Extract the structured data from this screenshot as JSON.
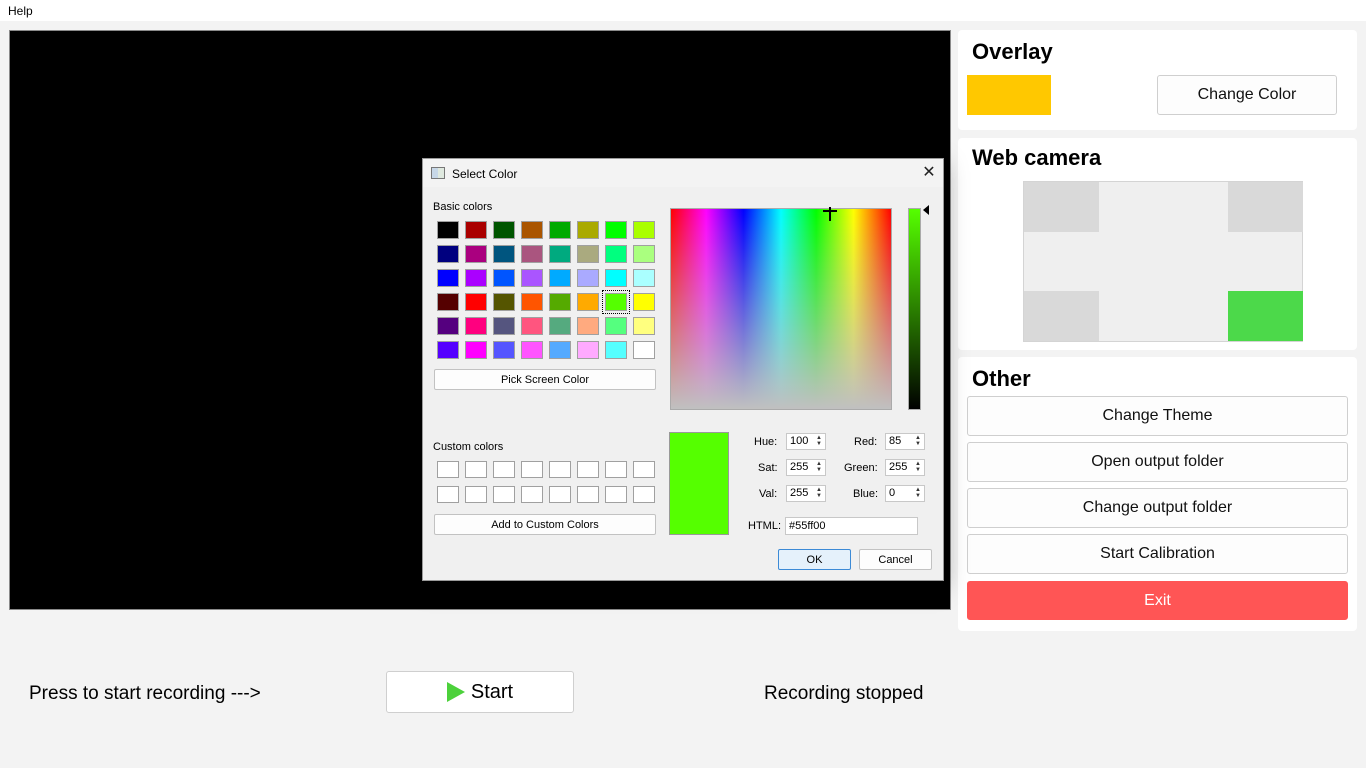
{
  "menu": {
    "help": "Help"
  },
  "overlay": {
    "title": "Overlay",
    "color": "#ffc800",
    "change_color_label": "Change Color"
  },
  "webcam": {
    "title": "Web camera",
    "active_corner_color": "#4cd94a"
  },
  "other": {
    "title": "Other",
    "buttons": {
      "change_theme": "Change Theme",
      "open_output_folder": "Open output folder",
      "change_output_folder": "Change output folder",
      "start_calibration": "Start Calibration",
      "exit": "Exit"
    }
  },
  "recording": {
    "prompt": "Press to start recording --->",
    "start_label": "Start",
    "status": "Recording stopped"
  },
  "dialog": {
    "title": "Select Color",
    "close_icon": "close-icon",
    "basic_colors_label": "Basic colors",
    "basic_colors": [
      "#000000",
      "#aa0000",
      "#005500",
      "#aa5500",
      "#00aa00",
      "#aaaa00",
      "#00ff00",
      "#aaff00",
      "#00007f",
      "#aa007f",
      "#00557f",
      "#aa557f",
      "#00aa7f",
      "#aaaa7f",
      "#00ff7f",
      "#aaff7f",
      "#0000ff",
      "#aa00ff",
      "#0055ff",
      "#aa55ff",
      "#00aaff",
      "#aaaaff",
      "#00ffff",
      "#aaffff",
      "#550000",
      "#ff0000",
      "#555500",
      "#ff5500",
      "#55aa00",
      "#ffaa00",
      "#55ff00",
      "#ffff00",
      "#55007f",
      "#ff007f",
      "#55557f",
      "#ff557f",
      "#55aa7f",
      "#ffaa7f",
      "#55ff7f",
      "#ffff7f",
      "#5500ff",
      "#ff00ff",
      "#5555ff",
      "#ff55ff",
      "#55aaff",
      "#ffaaff",
      "#55ffff",
      "#ffffff"
    ],
    "selected_basic_index": 30,
    "pick_screen_color": "Pick Screen Color",
    "custom_colors_label": "Custom colors",
    "add_to_custom": "Add to Custom Colors",
    "current_color": "#55ff00",
    "fields": {
      "hue_label": "Hue:",
      "hue": "100",
      "sat_label": "Sat:",
      "sat": "255",
      "val_label": "Val:",
      "val": "255",
      "red_label": "Red:",
      "red": "85",
      "green_label": "Green:",
      "green": "255",
      "blue_label": "Blue:",
      "blue": "0",
      "html_label": "HTML:",
      "html": "#55ff00"
    },
    "ok": "OK",
    "cancel": "Cancel"
  }
}
